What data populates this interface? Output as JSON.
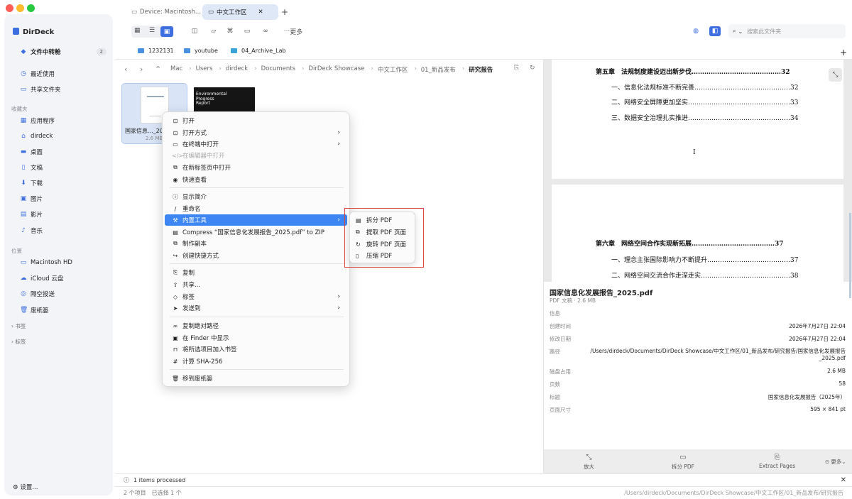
{
  "colors": {
    "accent": "#3d86f4",
    "close": "#ff5f57",
    "minimize": "#febc2e",
    "zoom": "#28c840",
    "annotation": "#d8453a"
  },
  "sidebar": {
    "app_title": "DirDeck",
    "transfer": {
      "label": "文件中转舱",
      "count": "2"
    },
    "recent": "最近使用",
    "shared": "共享文件夹",
    "favorites_header": "收藏夹",
    "favorites": [
      {
        "label": "应用程序",
        "icon": "apps-icon"
      },
      {
        "label": "dirdeck",
        "icon": "home-icon"
      },
      {
        "label": "桌面",
        "icon": "desktop-icon"
      },
      {
        "label": "文稿",
        "icon": "document-icon"
      },
      {
        "label": "下载",
        "icon": "download-icon"
      },
      {
        "label": "图片",
        "icon": "photo-icon"
      },
      {
        "label": "影片",
        "icon": "movie-icon"
      },
      {
        "label": "音乐",
        "icon": "music-icon"
      }
    ],
    "locations_header": "位置",
    "locations": [
      {
        "label": "Macintosh HD",
        "icon": "disk-icon"
      },
      {
        "label": "iCloud 云盘",
        "icon": "cloud-icon"
      },
      {
        "label": "隔空投送",
        "icon": "airdrop-icon"
      },
      {
        "label": "废纸篓",
        "icon": "trash-icon"
      }
    ],
    "bookmarks_header": "书签",
    "tags_header": "标签",
    "settings": "设置..."
  },
  "tabs": [
    {
      "label": "Device: Macintosh..."
    },
    {
      "label": "中文工作区"
    }
  ],
  "toolbar": {
    "more": "更多",
    "search_placeholder": "搜索此文件夹"
  },
  "bookmarks": [
    {
      "label": "1232131"
    },
    {
      "label": "youtube"
    },
    {
      "label": "04_Archive_Lab"
    }
  ],
  "breadcrumb": [
    "Mac",
    "Users",
    "dirdeck",
    "Documents",
    "DirDeck Showcase",
    "中文工作区",
    "01_新品发布",
    "研究报告"
  ],
  "files": [
    {
      "name": "国家信息..._2025.pdf",
      "size": "2.6 MB"
    },
    {
      "name": "Environmental Progress Report",
      "title_lines": [
        "Environmental",
        "Progress",
        "Report"
      ]
    }
  ],
  "context_menu": {
    "items": [
      {
        "label": "打开",
        "icon": "open-icon"
      },
      {
        "label": "打开方式",
        "icon": "open-with-icon",
        "submenu": true
      },
      {
        "label": "在终端中打开",
        "icon": "terminal-icon",
        "submenu": true
      },
      {
        "label": "在编辑器中打开",
        "icon": "code-icon",
        "disabled": true
      },
      {
        "label": "在新标签页中打开",
        "icon": "new-tab-icon"
      },
      {
        "label": "快速查看",
        "icon": "eye-icon"
      },
      {
        "label": "显示简介",
        "icon": "info-icon"
      },
      {
        "label": "重命名",
        "icon": "pencil-icon"
      },
      {
        "label": "内置工具",
        "icon": "tools-icon",
        "submenu": true,
        "highlighted": true
      },
      {
        "label": "Compress “国家信息化发展报告_2025.pdf” to ZIP",
        "icon": "archive-icon"
      },
      {
        "label": "制作副本",
        "icon": "duplicate-icon"
      },
      {
        "label": "创建快捷方式",
        "icon": "shortcut-icon"
      },
      {
        "label": "复制",
        "icon": "copy-icon"
      },
      {
        "label": "共享...",
        "icon": "share-icon"
      },
      {
        "label": "标签",
        "icon": "tag-icon",
        "submenu": true
      },
      {
        "label": "发送到",
        "icon": "send-icon",
        "submenu": true
      },
      {
        "label": "复制绝对路径",
        "icon": "link-icon"
      },
      {
        "label": "在 Finder 中显示",
        "icon": "finder-icon"
      },
      {
        "label": "将所选项目加入书签",
        "icon": "bookmark-icon"
      },
      {
        "label": "计算 SHA-256",
        "icon": "hash-icon"
      },
      {
        "label": "移到废纸篓",
        "icon": "trash-icon"
      }
    ],
    "submenu": [
      {
        "label": "拆分 PDF",
        "icon": "split-icon"
      },
      {
        "label": "提取 PDF 页面",
        "icon": "extract-icon"
      },
      {
        "label": "旋转 PDF 页面",
        "icon": "rotate-icon"
      },
      {
        "label": "压缩 PDF",
        "icon": "compress-icon"
      }
    ]
  },
  "preview": {
    "page1": [
      {
        "text": "第五章　法规制度建设迈出新步伐……………………………………32",
        "bold": true
      },
      {
        "text": "一、信息化法规标准不断完善………………………………………32"
      },
      {
        "text": "二、网络安全屏障更加坚实…………………………………………33"
      },
      {
        "text": "三、数据安全治理扎实推进…………………………………………34"
      }
    ],
    "page_number": "I",
    "page2": [
      {
        "text": "第六章　网络空间合作实现新拓展…………………………………37",
        "bold": true
      },
      {
        "text": "一、理念主张国际影响力不断提升…………………………………37"
      },
      {
        "text": "二、网络空间交流合作走深走实……………………………………38"
      }
    ]
  },
  "info": {
    "title": "国家信息化发展报告_2025.pdf",
    "subtitle": "PDF 文稿 · 2.6 MB",
    "section": "信息",
    "rows": [
      {
        "key": "创建时间",
        "value": "2026年7月27日 22:04"
      },
      {
        "key": "修改日期",
        "value": "2026年7月27日 22:04"
      },
      {
        "key": "路径",
        "value": "/Users/dirdeck/Documents/DirDeck Showcase/中文工作区/01_新品发布/研究报告/国家信息化发展报告_2025.pdf"
      },
      {
        "key": "磁盘占用",
        "value": "2.6 MB"
      },
      {
        "key": "页数",
        "value": "58"
      },
      {
        "key": "标题",
        "value": "国家信息化发展报告（2025年）"
      },
      {
        "key": "页面尺寸",
        "value": "595 × 841 pt"
      }
    ]
  },
  "preview_toolbar": [
    {
      "label": "放大",
      "icon": "zoom-icon"
    },
    {
      "label": "拆分 PDF",
      "icon": "split-icon"
    },
    {
      "label": "Extract Pages",
      "icon": "extract-icon"
    },
    {
      "label": "更多",
      "icon": "more-icon"
    }
  ],
  "status": {
    "processed": "1 items processed",
    "selection": "2 个项目　已选择 1 个",
    "path": "/Users/dirdeck/Documents/DirDeck Showcase/中文工作区/01_新品发布/研究报告"
  }
}
